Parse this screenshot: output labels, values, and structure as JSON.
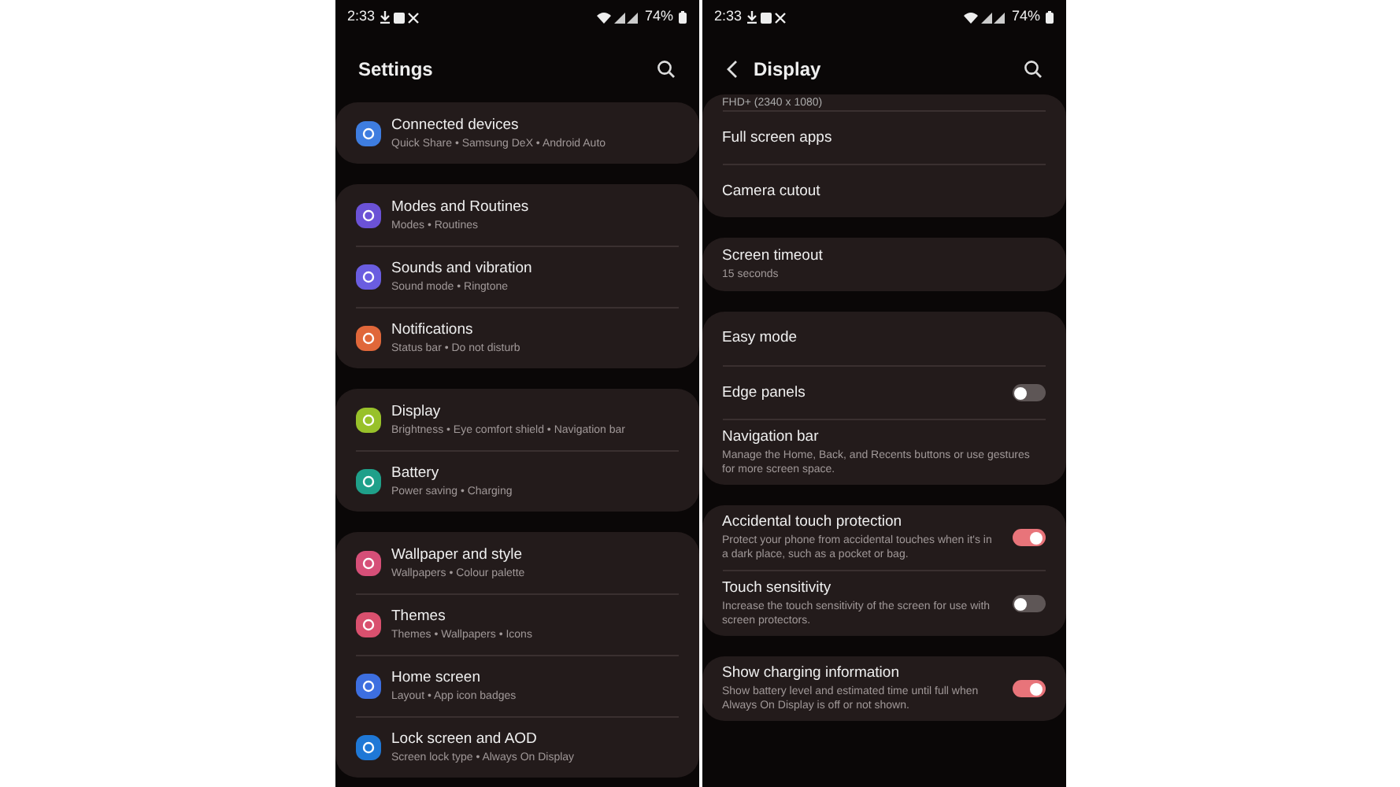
{
  "screens": [
    {
      "status_bar": {
        "time": "2:33",
        "battery": "74%"
      },
      "title": "Settings",
      "back": false,
      "groups": [
        {
          "items": [
            {
              "kind": "app",
              "title": "Connected devices",
              "subtitle": "Quick Share • Samsung DeX • Android Auto",
              "color": "#3e7de0"
            }
          ]
        },
        {
          "items": [
            {
              "kind": "app",
              "title": "Modes and Routines",
              "subtitle": "Modes • Routines",
              "color": "#6b52d6"
            },
            {
              "kind": "app",
              "title": "Sounds and vibration",
              "subtitle": "Sound mode • Ringtone",
              "color": "#6a5de0"
            },
            {
              "kind": "app",
              "title": "Notifications",
              "subtitle": "Status bar • Do not disturb",
              "color": "#e0673a"
            }
          ]
        },
        {
          "items": [
            {
              "kind": "app",
              "title": "Display",
              "subtitle": "Brightness • Eye comfort shield • Navigation bar",
              "color": "#98c12a"
            },
            {
              "kind": "app",
              "title": "Battery",
              "subtitle": "Power saving • Charging",
              "color": "#1fa08a"
            }
          ]
        },
        {
          "items": [
            {
              "kind": "app",
              "title": "Wallpaper and style",
              "subtitle": "Wallpapers • Colour palette",
              "color": "#d64f78"
            },
            {
              "kind": "app",
              "title": "Themes",
              "subtitle": "Themes • Wallpapers • Icons",
              "color": "#d9506e"
            },
            {
              "kind": "app",
              "title": "Home screen",
              "subtitle": "Layout • App icon badges",
              "color": "#3d6fe0"
            },
            {
              "kind": "app",
              "title": "Lock screen and AOD",
              "subtitle": "Screen lock type • Always On Display",
              "color": "#1f78d6"
            }
          ]
        }
      ]
    },
    {
      "status_bar": {
        "time": "2:33",
        "battery": "74%"
      },
      "title": "Display",
      "back": true,
      "groups": [
        {
          "items": [
            {
              "kind": "partial",
              "title": "FHD+ (2340 x 1080)"
            },
            {
              "kind": "plain",
              "title": "Full screen apps"
            },
            {
              "kind": "plain",
              "title": "Camera cutout"
            }
          ]
        },
        {
          "items": [
            {
              "kind": "plain",
              "title": "Screen timeout",
              "subtitle": "15 seconds"
            }
          ]
        },
        {
          "items": [
            {
              "kind": "plain",
              "title": "Easy mode"
            },
            {
              "kind": "switch",
              "title": "Edge panels",
              "on": false
            },
            {
              "kind": "plain",
              "title": "Navigation bar",
              "subtitle": "Manage the Home, Back, and Recents buttons or use gestures for more screen space."
            }
          ]
        },
        {
          "items": [
            {
              "kind": "switch",
              "title": "Accidental touch protection",
              "subtitle": "Protect your phone from accidental touches when it's in a dark place, such as a pocket or bag.",
              "on": true
            },
            {
              "kind": "switch",
              "title": "Touch sensitivity",
              "subtitle": "Increase the touch sensitivity of the screen for use with screen protectors.",
              "on": false
            }
          ]
        },
        {
          "items": [
            {
              "kind": "switch",
              "title": "Show charging information",
              "subtitle": "Show battery level and estimated time until full when Always On Display is off or not shown.",
              "on": true
            }
          ]
        }
      ]
    }
  ]
}
